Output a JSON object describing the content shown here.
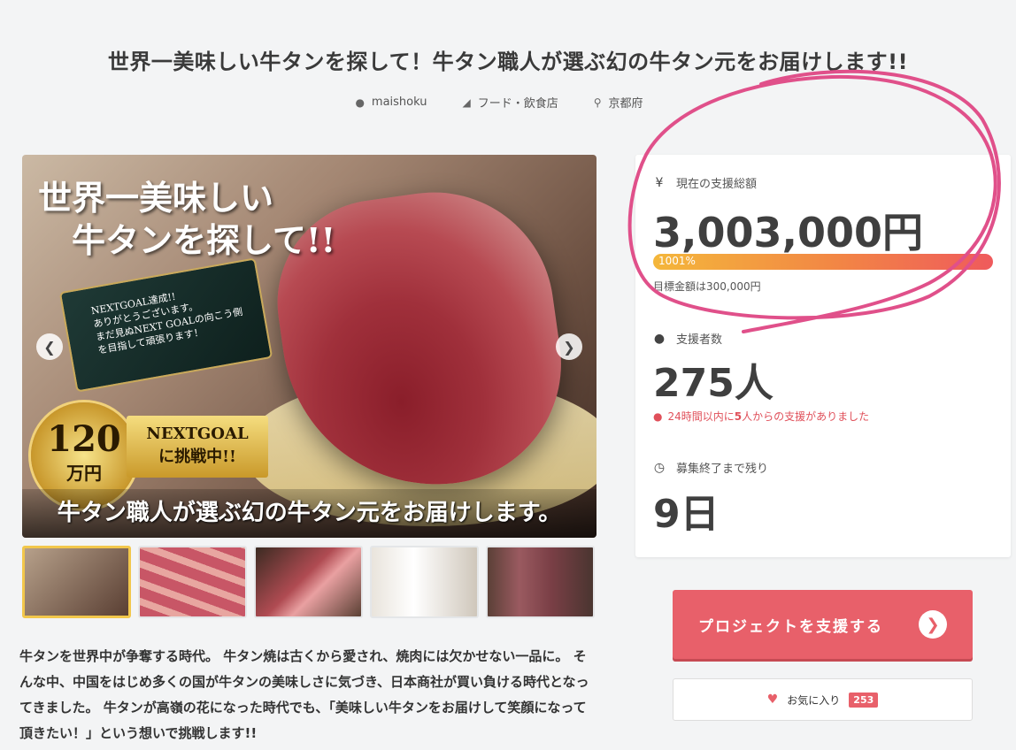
{
  "project": {
    "title": "世界一美味しい牛タンを探して！牛タン職人が選ぶ幻の牛タン元をお届けします!!",
    "author": "maishoku",
    "category": "フード・飲食店",
    "location": "京都府"
  },
  "hero": {
    "headline": "世界一美味しい\n　牛タンを探して!!",
    "card_text": "NEXTGOAL達成!!\nありがとうございます。\nまだ見ぬNEXT GOALの向こう側\nを目指して頑張ります！",
    "medal_value": "120",
    "medal_unit": "万円",
    "goal_badge": "NEXTGOAL\nに挑戦中!!",
    "bottom_caption": "牛タン職人が選ぶ幻の牛タン元をお届けします。"
  },
  "thumbnails_count": 5,
  "description": "牛タンを世界中が争奪する時代。 牛タン焼は古くから愛され、焼肉には欠かせない一品に。 そんな中、中国をはじめ多くの国が牛タンの美味しさに気づき、日本商社が買い負ける時代となってきました。 牛タンが高嶺の花になった時代でも、「美味しい牛タンをお届けして笑顔になって頂きたい！」という想いで挑戦します!!",
  "stats": {
    "funding_label": "現在の支援総額",
    "funding_amount": "3,003,000円",
    "progress_label": "1001%",
    "progress_fraction": 1.0,
    "target_text": "目標金額は300,000円",
    "supporters_label": "支援者数",
    "supporters_count": "275人",
    "recent_prefix": "24時間以内に",
    "recent_count": "5",
    "recent_suffix": "人からの支援がありました",
    "remaining_label": "募集終了まで残り",
    "remaining_value": "9日"
  },
  "actions": {
    "support_label": "プロジェクトを支援する",
    "favorite_label": "お気に入り",
    "favorite_count": "253"
  },
  "icons": {
    "user": "user-icon",
    "tag": "tag-icon",
    "pin": "map-pin-icon",
    "yen": "yen-icon",
    "clock": "clock-icon",
    "heart": "heart-icon"
  },
  "colors": {
    "accent": "#e8606a",
    "annotation": "#e0508a",
    "progress_start": "#f4b73b",
    "progress_end": "#ef5a5c"
  }
}
